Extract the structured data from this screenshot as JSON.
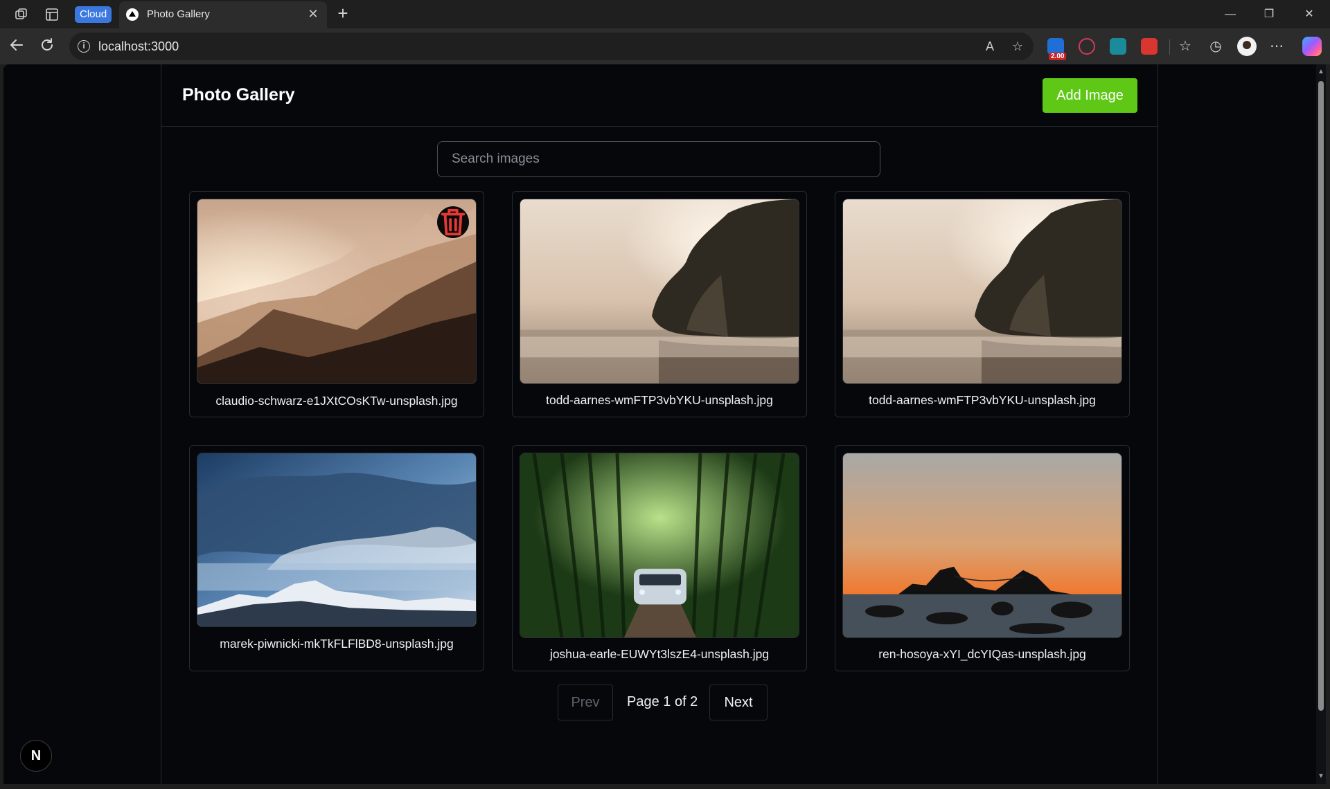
{
  "browser": {
    "profile_badge": "Cloud",
    "tab_title": "Photo Gallery",
    "url": "localhost:3000",
    "extension_badge": "2.00",
    "accent": "#3a78e0"
  },
  "app": {
    "title": "Photo Gallery",
    "add_button": "Add Image",
    "add_button_color": "#5fc715",
    "search_placeholder": "Search images",
    "search_value": ""
  },
  "gallery": {
    "items": [
      {
        "filename": "claudio-schwarz-e1JXtCOsKTw-unsplash.jpg",
        "image": "misty-mountains",
        "has_delete": true
      },
      {
        "filename": "todd-aarnes-wmFTP3vbYKU-unsplash.jpg",
        "image": "foggy-lake-trees",
        "has_delete": false
      },
      {
        "filename": "todd-aarnes-wmFTP3vbYKU-unsplash.jpg",
        "image": "foggy-lake-trees",
        "has_delete": false
      },
      {
        "filename": "marek-piwnicki-mkTkFLFlBD8-unsplash.jpg",
        "image": "storm-clouds-mountain",
        "has_delete": false
      },
      {
        "filename": "joshua-earle-EUWYt3lszE4-unsplash.jpg",
        "image": "bamboo-forest-car",
        "has_delete": false
      },
      {
        "filename": "ren-hosoya-xYI_dcYIQas-unsplash.jpg",
        "image": "sunset-sea-rocks",
        "has_delete": false
      }
    ]
  },
  "pagination": {
    "prev_label": "Prev",
    "page_text": "Page 1 of 2",
    "next_label": "Next",
    "current_page": 1,
    "total_pages": 2
  },
  "dev_badge": "N"
}
